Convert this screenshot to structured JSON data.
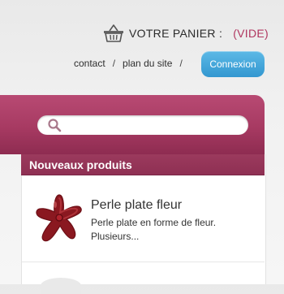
{
  "header": {
    "cart": {
      "icon": "basket-icon",
      "label": "VOTRE PANIER :",
      "status": "(VIDE)",
      "status_color": "#b0365f"
    },
    "links": [
      {
        "label": "contact"
      },
      {
        "label": "plan du site"
      }
    ],
    "separator": "/",
    "login_label": "Connexion",
    "login_color": "#3a9fd6"
  },
  "search": {
    "icon": "search-icon",
    "placeholder": ""
  },
  "new_products": {
    "title": "Nouveaux produits",
    "accent_color": "#9b3a5d",
    "items": [
      {
        "name": "Perle plate fleur",
        "description": "Perle plate en forme de fleur. Plusieurs...",
        "image_icon": "red-flower-bead-icon"
      }
    ]
  }
}
